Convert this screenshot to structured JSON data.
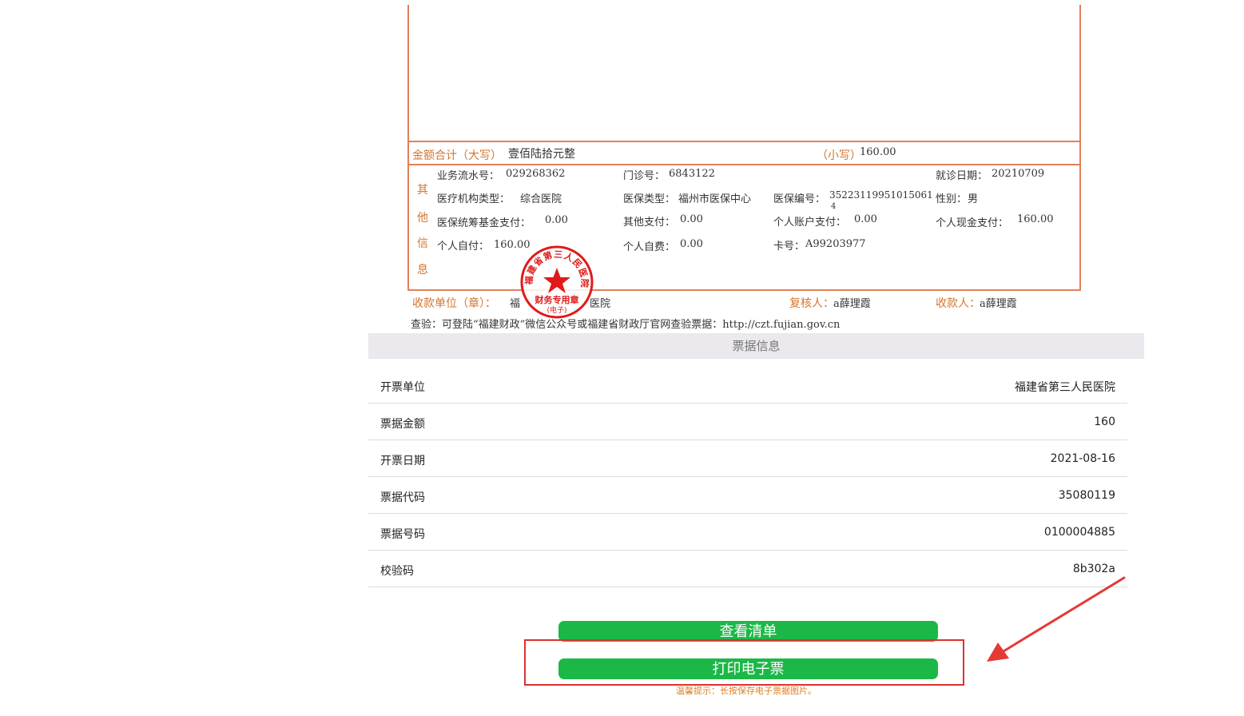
{
  "invoice": {
    "total_upper_label": "金额合计（大写）",
    "total_upper_value": "壹佰陆拾元整",
    "total_lower_label": "（小写）",
    "total_lower_value": "160.00",
    "other_info_chars": [
      "其",
      "他",
      "信",
      "息"
    ],
    "fields": {
      "serial_label": "业务流水号：",
      "serial_value": "029268362",
      "clinic_no_label": "门诊号：",
      "clinic_no_value": "6843122",
      "visit_date_label": "就诊日期：",
      "visit_date_value": "20210709",
      "inst_type_label": "医疗机构类型：",
      "inst_type_value": "综合医院",
      "ins_type_label": "医保类型：",
      "ins_type_value": "福州市医保中心",
      "ins_no_label": "医保编号：",
      "ins_no_value": "35223119951015061",
      "ins_no_wrap": "4",
      "gender_label": "性别：",
      "gender_value": "男",
      "pool_fund_label": "医保统筹基金支付：",
      "pool_fund_value": "0.00",
      "other_pay_label": "其他支付：",
      "other_pay_value": "0.00",
      "personal_acct_label": "个人账户支付：",
      "personal_acct_value": "0.00",
      "personal_cash_label": "个人现金支付：",
      "personal_cash_value": "160.00",
      "self_pay_label": "个人自付：",
      "self_pay_value": "160.00",
      "self_fee_label": "个人自费：",
      "self_fee_value": "0.00",
      "card_no_label": "卡号：",
      "card_no_value": "A99203977"
    },
    "payee_unit_label": "收款单位（章）：",
    "payee_unit_value_start": "福",
    "payee_unit_value_end": "医院",
    "reviewer_label": "复核人：",
    "reviewer_value": "a薛理霞",
    "cashier_label": "收款人：",
    "cashier_value": "a薛理霞",
    "verify_text": "查验：可登陆“福建财政”微信公众号或福建省财政厅官网查验票据：http://czt.fujian.gov.cn",
    "seal_text": "福建省第三人民医院",
    "seal_sub1": "财务专用章",
    "seal_sub2": "(电子)"
  },
  "info": {
    "header": "票据信息",
    "rows": [
      {
        "label": "开票单位",
        "value": "福建省第三人民医院"
      },
      {
        "label": "票据金额",
        "value": "160"
      },
      {
        "label": "开票日期",
        "value": "2021-08-16"
      },
      {
        "label": "票据代码",
        "value": "35080119"
      },
      {
        "label": "票据号码",
        "value": "0100004885"
      },
      {
        "label": "校验码",
        "value": "8b302a"
      }
    ]
  },
  "buttons": {
    "view_list": "查看清单",
    "print_ticket": "打印电子票"
  },
  "tip": "温馨提示：长按保存电子票据图片。",
  "colors": {
    "accent_green": "#1cb847",
    "invoice_border": "#e0805a",
    "seal_red": "#e01a1a",
    "highlight_red": "#e03030"
  }
}
